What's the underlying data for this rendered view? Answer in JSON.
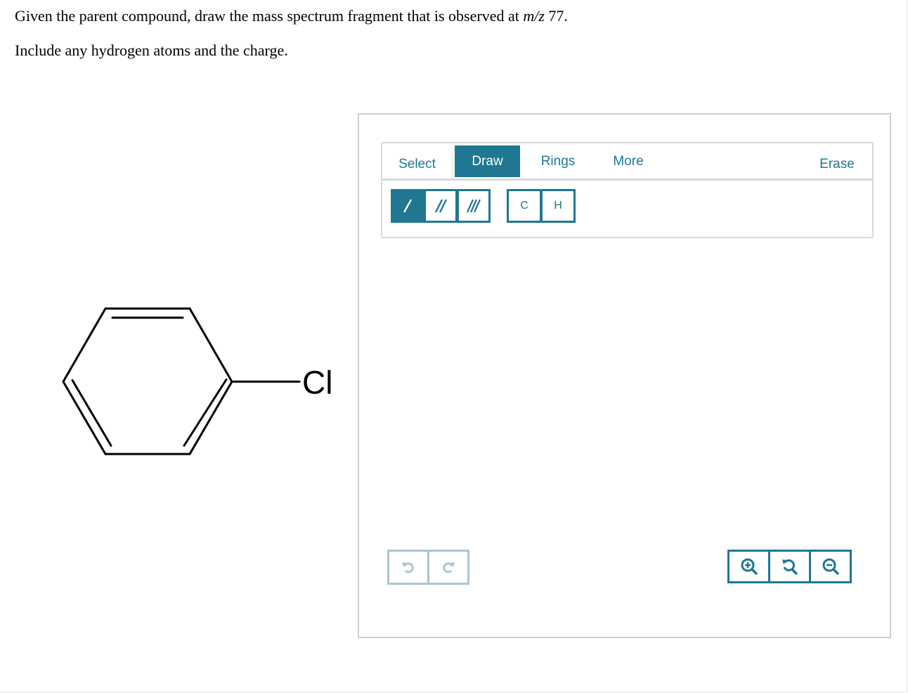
{
  "question": {
    "line1_before": "Given the parent compound, draw the mass spectrum fragment that is observed at ",
    "line1_mz": "m/z",
    "line1_after": " 77.",
    "line2": "Include any hydrogen atoms and the charge."
  },
  "molecule": {
    "substituent_label": "Cl"
  },
  "editor": {
    "tabs": {
      "select": "Select",
      "draw": "Draw",
      "rings": "Rings",
      "more": "More",
      "erase": "Erase"
    },
    "active_tab": "Draw",
    "atoms": {
      "carbon": "C",
      "hydrogen": "H"
    },
    "icons": {
      "single_bond": "single-bond-icon",
      "double_bond": "double-bond-icon",
      "triple_bond": "triple-bond-icon",
      "undo": "undo-icon",
      "redo": "redo-icon",
      "zoom_in": "zoom-in-icon",
      "zoom_reset": "zoom-reset-icon",
      "zoom_out": "zoom-out-icon"
    },
    "colors": {
      "accent": "#1f7792",
      "disabled": "#a9c6d2",
      "border": "#cfcfcf"
    }
  }
}
